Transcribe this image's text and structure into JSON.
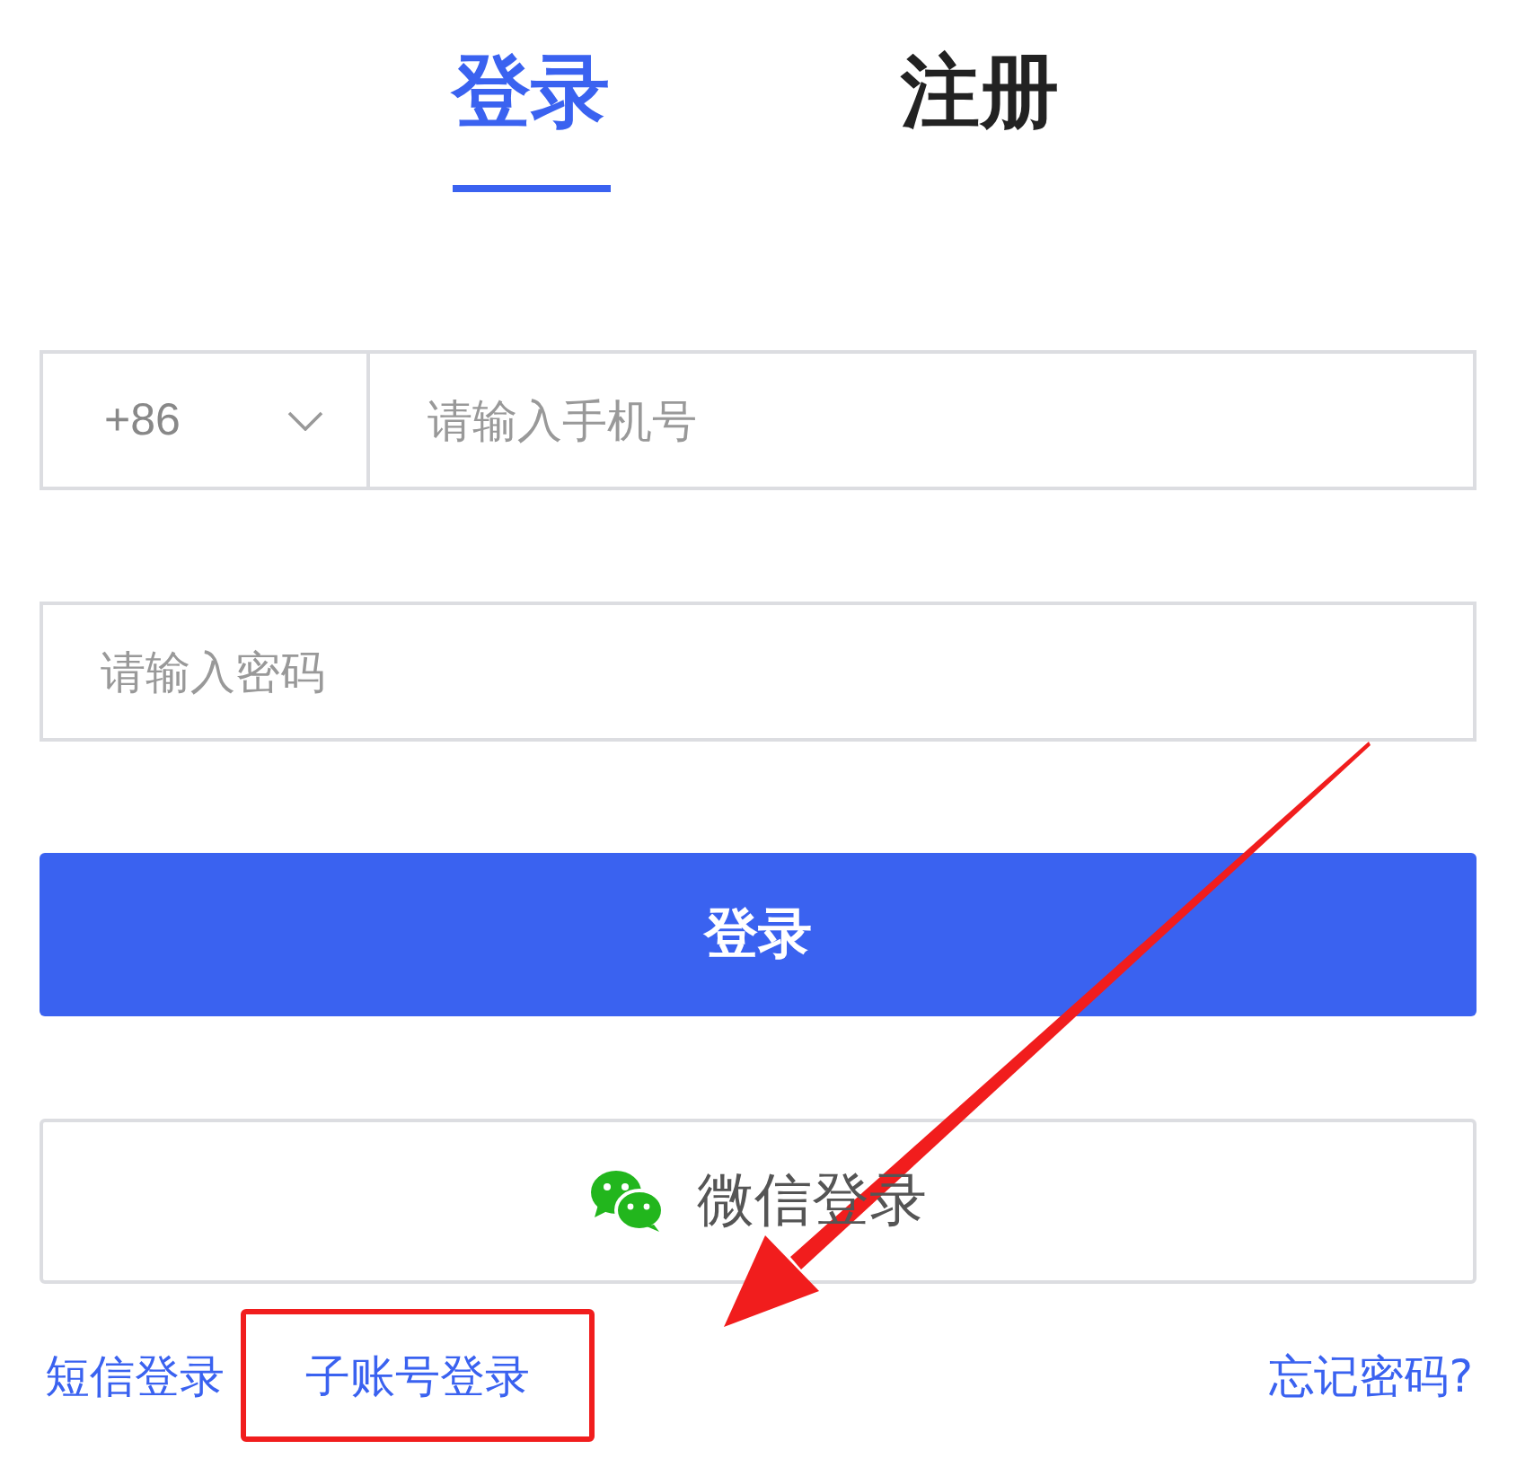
{
  "tabs": [
    {
      "label": "登录",
      "selected": true
    },
    {
      "label": "注册",
      "selected": false
    }
  ],
  "phone": {
    "country_code": "+86",
    "placeholder": "请输入手机号"
  },
  "password": {
    "placeholder": "请输入密码"
  },
  "login_button": "登录",
  "wechat_button": "微信登录",
  "left_links": [
    {
      "label": "短信登录",
      "highlighted": false
    },
    {
      "label": "子账号登录",
      "highlighted": true
    }
  ],
  "right_links": [
    {
      "label": "忘记密码?",
      "highlighted": false
    }
  ]
}
